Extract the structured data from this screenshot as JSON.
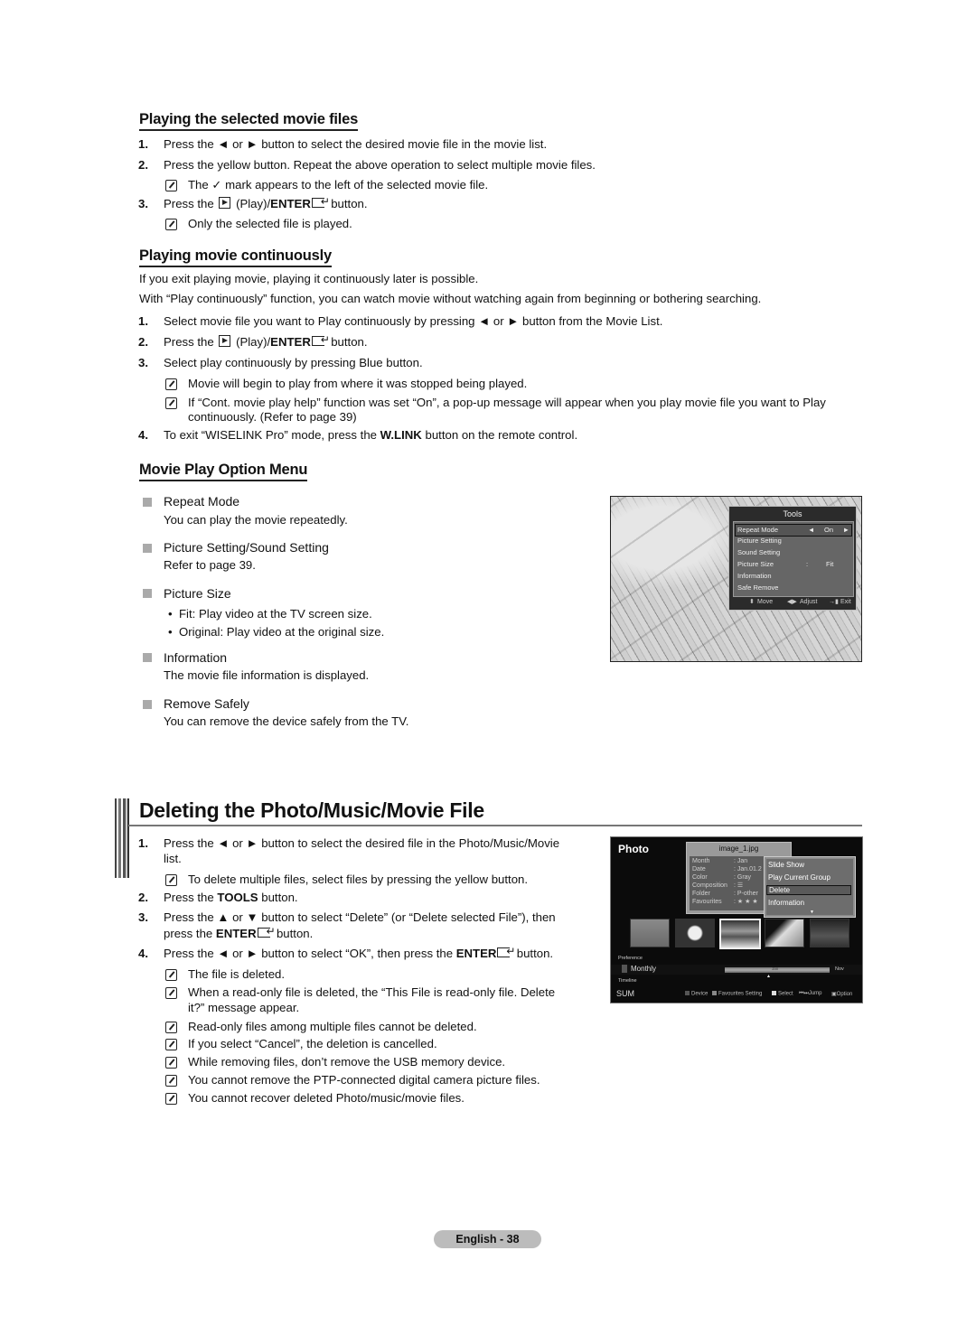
{
  "section1": {
    "title": "Playing the selected movie files",
    "steps": [
      {
        "num": "1.",
        "pre": "Press the ◄ or ► button to select the desired movie file in the movie list."
      },
      {
        "num": "2.",
        "pre": "Press the yellow button. Repeat the above operation to select multiple movie files."
      },
      {
        "num": "3.",
        "pre": "Press the",
        "mid": "(Play)/",
        "bold": "ENTER",
        "post": "button."
      }
    ],
    "notes": [
      {
        "pre": "The",
        "check": "✓",
        "post": "mark appears to the left of the selected movie file."
      },
      {
        "text": "Only the selected file is played."
      }
    ]
  },
  "section2": {
    "title": "Playing movie continuously",
    "intro": [
      "If you exit playing movie, playing it continuously later is possible.",
      "With “Play continuously” function, you can watch movie without watching again from beginning or bothering searching."
    ],
    "steps": [
      {
        "num": "1.",
        "text": "Select movie file you want to Play continuously by pressing ◄ or ► button from the Movie List."
      },
      {
        "num": "2.",
        "pre": "Press the",
        "mid": "(Play)/",
        "bold": "ENTER",
        "post": "button."
      },
      {
        "num": "3.",
        "text": "Select play continuously by pressing Blue button."
      },
      {
        "num": "4.",
        "pre": "To exit “WISELINK Pro” mode, press the",
        "bold": "W.LINK",
        "post": "button on the remote control."
      }
    ],
    "notes": [
      "Movie will begin to play from where it was stopped being played.",
      "If “Cont. movie play help” function was set “On”, a pop-up message will appear when you play movie file you want to Play",
      "continuously. (Refer to page 39)"
    ]
  },
  "section3": {
    "title": "Movie Play Option Menu",
    "options": [
      {
        "title": "Repeat Mode",
        "desc": "You can play the movie repeatedly."
      },
      {
        "title": "Picture Setting/Sound Setting",
        "desc": "Refer to page 39."
      },
      {
        "title": "Picture Size",
        "bullets": [
          "Fit: Play video at the TV screen size.",
          "Original: Play video at the original size."
        ]
      },
      {
        "title": "Information",
        "desc": "The movie file information is displayed."
      },
      {
        "title": "Remove Safely",
        "desc": "You can remove the device safely from the TV."
      }
    ],
    "tools_menu": {
      "title": "Tools",
      "rows": [
        {
          "label": "Repeat Mode",
          "value": "On",
          "selected": true
        },
        {
          "label": "Picture Setting"
        },
        {
          "label": "Sound Setting"
        },
        {
          "label": "Picture Size",
          "colon": ":",
          "value": "Fit"
        },
        {
          "label": "Information"
        },
        {
          "label": "Safe Remove"
        }
      ],
      "footer": {
        "move": "Move",
        "adjust": "Adjust",
        "exit": "Exit"
      }
    }
  },
  "section4": {
    "title": "Deleting the Photo/Music/Movie File",
    "steps": [
      {
        "num": "1.",
        "line1": "Press the ◄ or ► button to select the desired file in the Photo/Music/Movie",
        "line2": "list."
      },
      {
        "num": "2.",
        "pre": "Press the",
        "bold": "TOOLS",
        "post": "button."
      },
      {
        "num": "3.",
        "line1": "Press the ▲ or ▼ button to select “Delete” (or “Delete selected File”), then",
        "pre2": "press the",
        "bold2": "ENTER",
        "post2": "button."
      },
      {
        "num": "4.",
        "pre": "Press the ◄ or ► button to select “OK”, then press the",
        "bold": "ENTER",
        "post": "button."
      }
    ],
    "note_step1": "To delete multiple files, select files by pressing the yellow button.",
    "notes_step4": [
      "The file is deleted.",
      "When a read-only file is deleted, the “This File is read-only file. Delete",
      "it?” message appear.",
      "Read-only files among multiple files cannot be deleted.",
      "If you select “Cancel”, the deletion is cancelled.",
      "While removing files, don’t remove the USB memory device.",
      "You cannot remove the PTP-connected digital camera picture files.",
      "You cannot recover deleted Photo/music/movie files."
    ],
    "photo_screen": {
      "title": "Photo",
      "filename": "image_1.jpg",
      "info": [
        {
          "key": "Month",
          "value": ": Jan"
        },
        {
          "key": "Date",
          "value": ": Jan.01.2"
        },
        {
          "key": "Color",
          "value": ": Gray"
        },
        {
          "key": "Composition",
          "value": ": ☰"
        },
        {
          "key": "Folder",
          "value": ": P-other"
        },
        {
          "key": "Favourites",
          "value": ": ★ ★ ★"
        }
      ],
      "menu": [
        "Slide Show",
        "Play Current Group",
        "Delete",
        "Information"
      ],
      "menu_selected": "Delete",
      "preference": "Preference",
      "view_mode": "Monthly",
      "timeline": "Timeline",
      "slider_label": "Jan",
      "slider_end": "Nov",
      "sum": "SUM",
      "legend": {
        "device": "Device",
        "favourites": "Favourites Setting",
        "select": "Select",
        "jump": "Jump",
        "option": "Option"
      }
    }
  },
  "footer": {
    "page_label": "English - 38"
  },
  "colors": {
    "pill": "#bcbcbc",
    "osd_bg": "#2b2b2b",
    "osd_list": "#666666"
  }
}
